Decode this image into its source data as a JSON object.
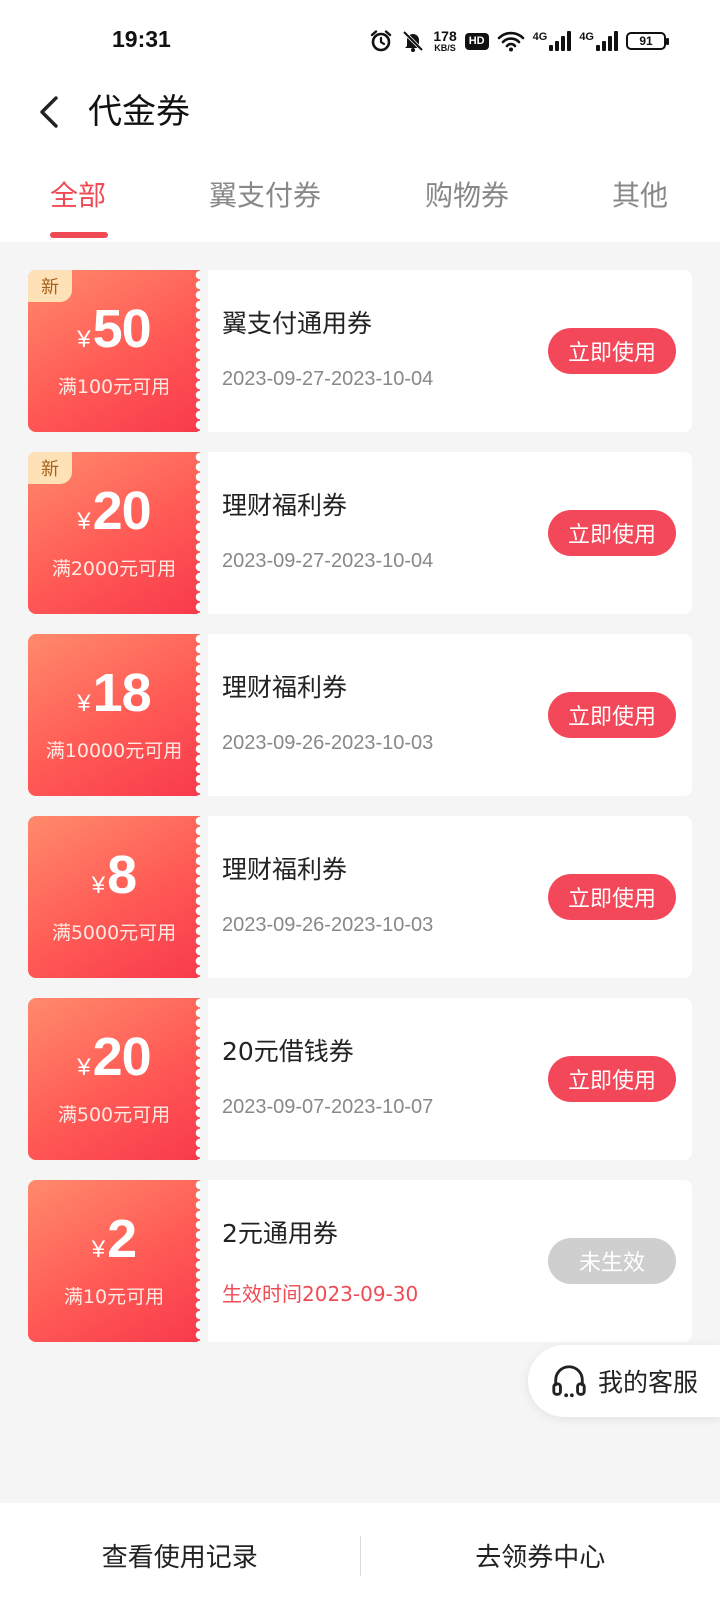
{
  "status_bar": {
    "time": "19:31",
    "net_speed_value": "178",
    "net_speed_unit": "KB/S",
    "hd_label": "HD",
    "signal1_label": "4G",
    "signal2_label": "4G",
    "battery_level": "91"
  },
  "header": {
    "title": "代金券"
  },
  "tabs": [
    {
      "label": "全部",
      "active": true
    },
    {
      "label": "翼支付券",
      "active": false
    },
    {
      "label": "购物券",
      "active": false
    },
    {
      "label": "其他",
      "active": false
    }
  ],
  "coupons": [
    {
      "new_badge": "新",
      "currency": "¥",
      "amount": "50",
      "condition": "满100元可用",
      "name": "翼支付通用券",
      "date": "2023-09-27-2023-10-04",
      "button": "立即使用"
    },
    {
      "new_badge": "新",
      "currency": "¥",
      "amount": "20",
      "condition": "满2000元可用",
      "name": "理财福利券",
      "date": "2023-09-27-2023-10-04",
      "button": "立即使用"
    },
    {
      "currency": "¥",
      "amount": "18",
      "condition": "满10000元可用",
      "name": "理财福利券",
      "date": "2023-09-26-2023-10-03",
      "button": "立即使用"
    },
    {
      "currency": "¥",
      "amount": "8",
      "condition": "满5000元可用",
      "name": "理财福利券",
      "date": "2023-09-26-2023-10-03",
      "button": "立即使用"
    },
    {
      "currency": "¥",
      "amount": "20",
      "condition": "满500元可用",
      "name": "20元借钱券",
      "date": "2023-09-07-2023-10-07",
      "button": "立即使用"
    },
    {
      "currency": "¥",
      "amount": "2",
      "condition": "满10元可用",
      "name": "2元通用券",
      "date": "生效时间2023-09-30",
      "button": "未生效"
    }
  ],
  "customer_service": {
    "label": "我的客服",
    "icon": "headset-icon"
  },
  "bottom_bar": {
    "history_label": "查看使用记录",
    "center_label": "去领券中心"
  },
  "colors": {
    "accent": "#f04a55",
    "button": "#f2485a",
    "disabled": "#cfcfcf",
    "coupon_gradient_start": "#ff8a6b",
    "coupon_gradient_end": "#f83a4c"
  }
}
